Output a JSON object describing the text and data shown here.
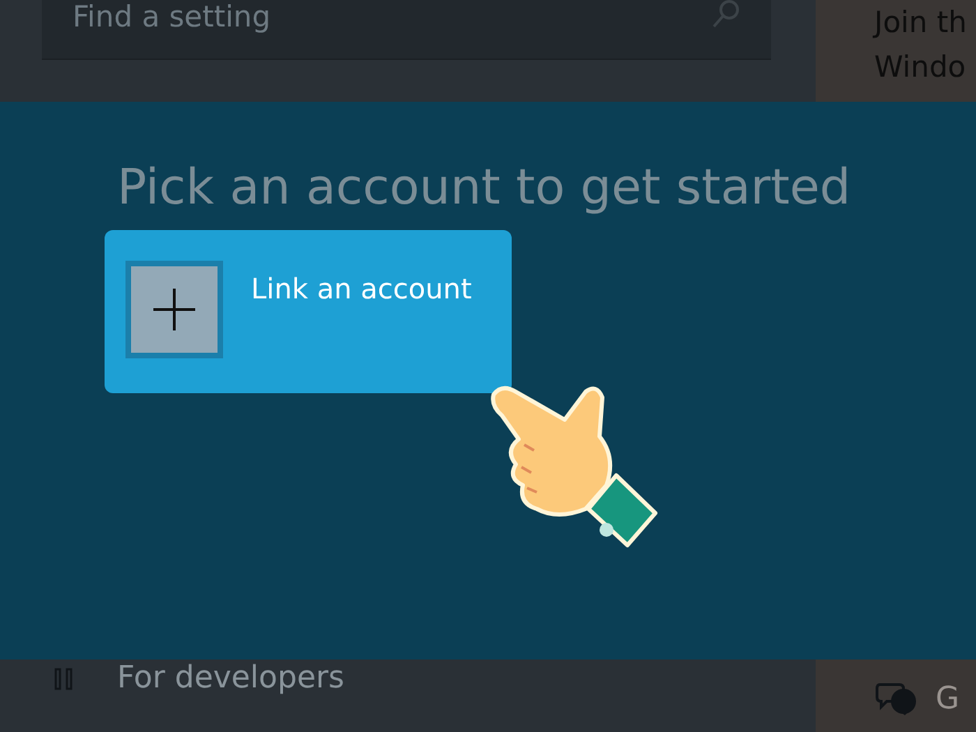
{
  "search": {
    "placeholder": "Find a setting"
  },
  "sidebar_text": [
    "Join th",
    "Windo"
  ],
  "nav_item": {
    "label": "For developers"
  },
  "footer_link": {
    "label": "G"
  },
  "dialog": {
    "title": "Pick an account to get started",
    "options": [
      {
        "kind": "add",
        "label": "Link an account"
      }
    ]
  }
}
